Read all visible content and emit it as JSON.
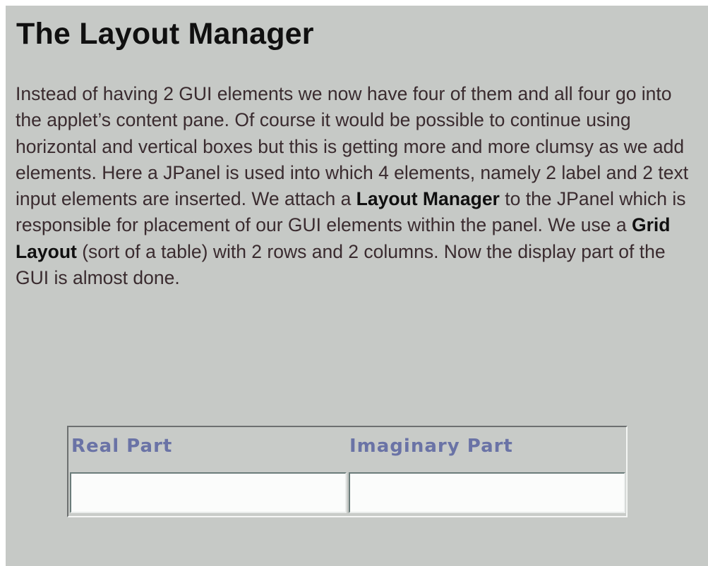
{
  "heading": "The Layout Manager",
  "paragraph": {
    "part1": "Instead of having 2 GUI elements we now have four of them and all four go into the applet’s content pane. Of course it would be possible to continue using horizontal and vertical boxes but this is getting more and more clumsy as we add elements. Here a JPanel is used into which 4 elements, namely 2 label and 2 text input elements are inserted. We attach a ",
    "bold1": "Layout Manager",
    "part2": " to the JPanel which is responsible for placement of our GUI elements within the panel. We use a ",
    "bold2": "Grid Layout",
    "part3": " (sort of a table) with 2 rows and 2 columns. Now the display part of the GUI is almost done."
  },
  "applet": {
    "real_label": "Real Part",
    "imaginary_label": "Imaginary Part",
    "real_value": "",
    "imaginary_value": ""
  },
  "colors": {
    "background": "#c6c9c6",
    "label_text": "#6a73a6",
    "field_background": "#fbfcfb"
  }
}
